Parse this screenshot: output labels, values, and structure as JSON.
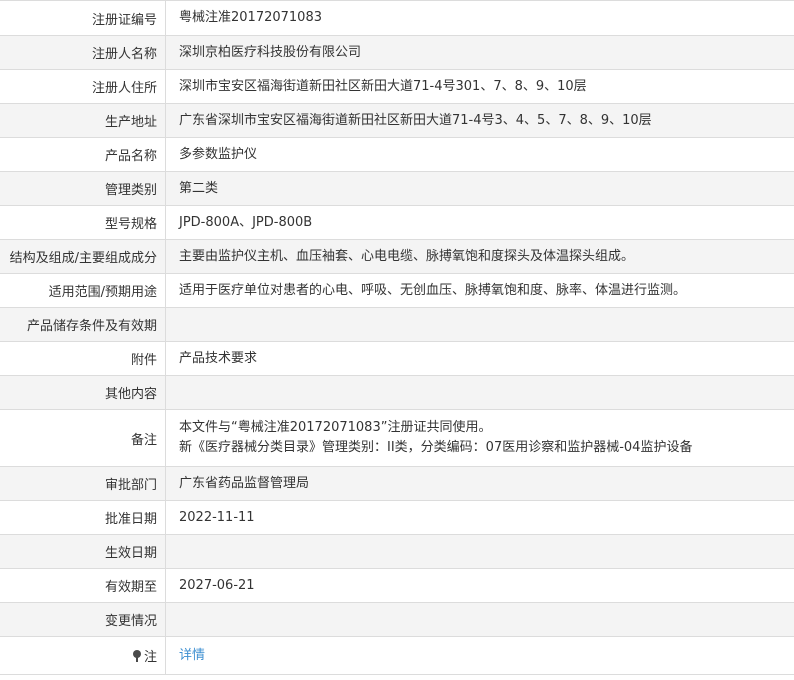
{
  "rows": [
    {
      "label": "注册证编号",
      "value": "粤械注准20172071083"
    },
    {
      "label": "注册人名称",
      "value": "深圳京柏医疗科技股份有限公司"
    },
    {
      "label": "注册人住所",
      "value": "深圳市宝安区福海街道新田社区新田大道71-4号301、7、8、9、10层"
    },
    {
      "label": "生产地址",
      "value": "广东省深圳市宝安区福海街道新田社区新田大道71-4号3、4、5、7、8、9、10层"
    },
    {
      "label": "产品名称",
      "value": "多参数监护仪"
    },
    {
      "label": "管理类别",
      "value": "第二类"
    },
    {
      "label": "型号规格",
      "value": "JPD-800A、JPD-800B"
    },
    {
      "label": "结构及组成/主要组成成分",
      "value": "主要由监护仪主机、血压袖套、心电电缆、脉搏氧饱和度探头及体温探头组成。"
    },
    {
      "label": "适用范围/预期用途",
      "value": "适用于医疗单位对患者的心电、呼吸、无创血压、脉搏氧饱和度、脉率、体温进行监测。"
    },
    {
      "label": "产品储存条件及有效期",
      "value": ""
    },
    {
      "label": "附件",
      "value": "产品技术要求"
    },
    {
      "label": "其他内容",
      "value": ""
    },
    {
      "label": "备注",
      "value": "本文件与“粤械注准20172071083”注册证共同使用。",
      "value2": "新《医疗器械分类目录》管理类别：II类，分类编码：07医用诊察和监护器械-04监护设备"
    },
    {
      "label": "审批部门",
      "value": "广东省药品监督管理局"
    },
    {
      "label": "批准日期",
      "value": "2022-11-11"
    },
    {
      "label": "生效日期",
      "value": ""
    },
    {
      "label": "有效期至",
      "value": "2027-06-21"
    },
    {
      "label": "变更情况",
      "value": ""
    }
  ],
  "note_row": {
    "label": "注",
    "icon": "pin-icon",
    "link_text": "详情",
    "link_color": "#3d8fd1"
  }
}
